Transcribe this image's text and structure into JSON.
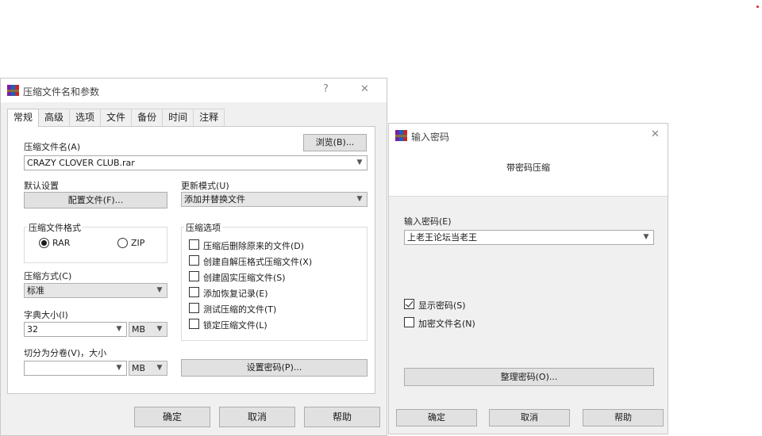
{
  "compress_dialog": {
    "title": "压缩文件名和参数",
    "help_glyph": "?",
    "close_glyph": "✕",
    "tabs": [
      "常规",
      "高级",
      "选项",
      "文件",
      "备份",
      "时间",
      "注释"
    ],
    "archive_name_label": "压缩文件名(A)",
    "archive_name_value": "CRAZY CLOVER CLUB.rar",
    "browse_button": "浏览(B)...",
    "default_settings_label": "默认设置",
    "profiles_button": "配置文件(F)...",
    "update_mode_label": "更新模式(U)",
    "update_mode_value": "添加并替换文件",
    "format_group_title": "压缩文件格式",
    "format_rar": "RAR",
    "format_zip": "ZIP",
    "format_selected": "RAR",
    "options_group_title": "压缩选项",
    "options": [
      {
        "label": "压缩后删除原来的文件(D)",
        "checked": false
      },
      {
        "label": "创建自解压格式压缩文件(X)",
        "checked": false
      },
      {
        "label": "创建固实压缩文件(S)",
        "checked": false
      },
      {
        "label": "添加恢复记录(E)",
        "checked": false
      },
      {
        "label": "测试压缩的文件(T)",
        "checked": false
      },
      {
        "label": "锁定压缩文件(L)",
        "checked": false
      }
    ],
    "method_label": "压缩方式(C)",
    "method_value": "标准",
    "dict_label": "字典大小(I)",
    "dict_value": "32",
    "dict_unit": "MB",
    "split_label": "切分为分卷(V)，大小",
    "split_value": "",
    "split_unit": "MB",
    "set_password_button": "设置密码(P)...",
    "ok_button": "确定",
    "cancel_button": "取消",
    "help_button": "帮助"
  },
  "password_dialog": {
    "title": "输入密码",
    "close_glyph": "✕",
    "heading": "带密码压缩",
    "password_label": "输入密码(E)",
    "password_value": "上老王论坛当老王",
    "show_password_label": "显示密码(S)",
    "show_password_checked": true,
    "encrypt_names_label": "加密文件名(N)",
    "encrypt_names_checked": false,
    "organize_button": "整理密码(O)...",
    "ok_button": "确定",
    "cancel_button": "取消",
    "help_button": "帮助"
  },
  "icons": {
    "app": "winrar-books-icon",
    "dropdown": "chevron-down-icon",
    "close": "close-icon",
    "help": "help-icon"
  }
}
